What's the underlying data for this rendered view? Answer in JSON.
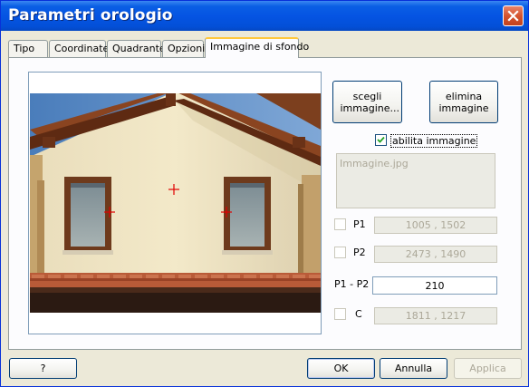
{
  "window": {
    "title": "Parametri orologio"
  },
  "tabs": [
    {
      "label": "Tipo"
    },
    {
      "label": "Coordinate"
    },
    {
      "label": "Quadrante"
    },
    {
      "label": "Opzioni"
    },
    {
      "label": "Immagine di sfondo",
      "active": true
    }
  ],
  "image_panel": {
    "choose_button": "scegli immagine...",
    "remove_button": "elimina immagine",
    "enable_label": "abilita immagine",
    "enable_checked": true,
    "filename": "Immagine.jpg",
    "points": [
      {
        "label": "P1",
        "value": "1005  ,  1502",
        "checked": false
      },
      {
        "label": "P2",
        "value": "2473  ,  1490",
        "checked": false
      }
    ],
    "distance_label": "P1 - P2",
    "distance_value": "210",
    "center": {
      "label": "C",
      "value": "1811  ,  1217",
      "checked": false
    }
  },
  "footer": {
    "help_button": "?",
    "ok_button": "OK",
    "cancel_button": "Annulla",
    "apply_button": "Applica"
  },
  "colors": {
    "titlebar": "#0554E3",
    "dialog_bg": "#ECE9D8",
    "active_tab_accent": "#FFC83C",
    "marker": "#E00000"
  }
}
